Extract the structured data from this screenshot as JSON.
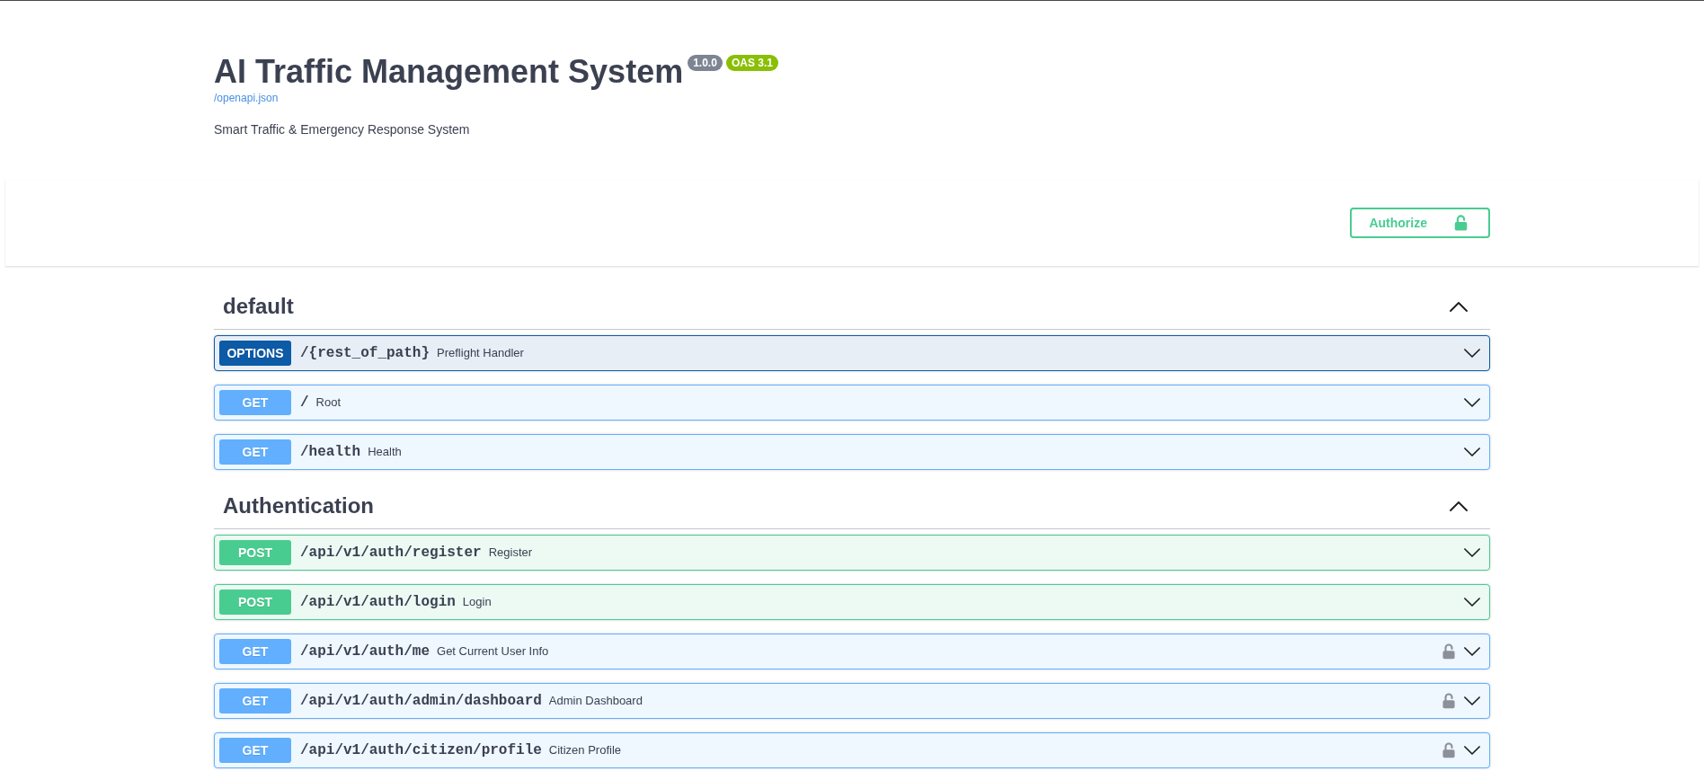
{
  "info": {
    "title": "AI Traffic Management System",
    "version": "1.0.0",
    "oas": "OAS 3.1",
    "spec_link": "/openapi.json",
    "description": "Smart Traffic & Emergency Response System"
  },
  "authorize_button": {
    "label": "Authorize"
  },
  "sections": [
    {
      "name": "default",
      "expanded": true,
      "operations": [
        {
          "kind": "options",
          "method": "OPTIONS",
          "path": "/{rest_of_path}",
          "summary": "Preflight Handler",
          "secured": false,
          "expanded": false
        },
        {
          "kind": "get",
          "method": "GET",
          "path": "/",
          "summary": "Root",
          "secured": false,
          "expanded": false
        },
        {
          "kind": "get",
          "method": "GET",
          "path": "/health",
          "summary": "Health",
          "secured": false,
          "expanded": false
        }
      ]
    },
    {
      "name": "Authentication",
      "expanded": true,
      "operations": [
        {
          "kind": "post",
          "method": "POST",
          "path": "/api/v1/auth/register",
          "summary": "Register",
          "secured": false,
          "expanded": false
        },
        {
          "kind": "post",
          "method": "POST",
          "path": "/api/v1/auth/login",
          "summary": "Login",
          "secured": false,
          "expanded": false
        },
        {
          "kind": "get",
          "method": "GET",
          "path": "/api/v1/auth/me",
          "summary": "Get Current User Info",
          "secured": true,
          "expanded": false
        },
        {
          "kind": "get",
          "method": "GET",
          "path": "/api/v1/auth/admin/dashboard",
          "summary": "Admin Dashboard",
          "secured": true,
          "expanded": false
        },
        {
          "kind": "get",
          "method": "GET",
          "path": "/api/v1/auth/citizen/profile",
          "summary": "Citizen Profile",
          "secured": true,
          "expanded": false
        }
      ]
    }
  ]
}
